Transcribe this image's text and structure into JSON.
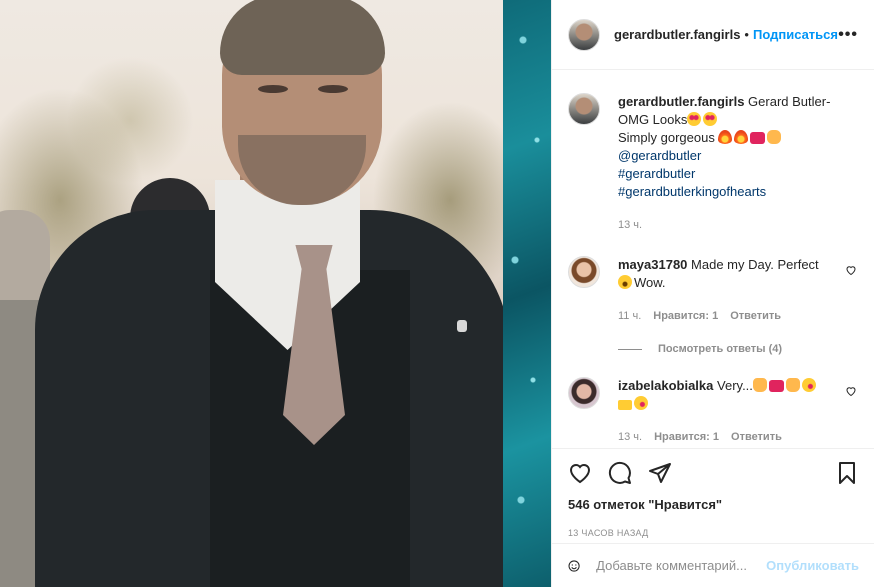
{
  "header": {
    "username": "gerardbutler.fangirls",
    "separator": "•",
    "follow_label": "Подписаться",
    "more_label": "•••"
  },
  "caption": {
    "username": "gerardbutler.fangirls",
    "text_1": "Gerard Butler-OMG Looks",
    "text_2": "Simply gorgeous",
    "mention": "@gerardbutler",
    "hashtags": [
      "#gerardbutler",
      "#gerardbutlerkingofhearts"
    ],
    "time": "13 ч."
  },
  "comments": [
    {
      "username": "maya31780",
      "text": "Made my Day. Perfect",
      "text_2": "Wow.",
      "time": "11 ч.",
      "likes": "Нравится: 1",
      "reply": "Ответить",
      "view_replies": "Посмотреть ответы (4)"
    },
    {
      "username": "izabelakobialka",
      "text": "Very...",
      "time": "13 ч.",
      "likes": "Нравится: 1",
      "reply": "Ответить"
    }
  ],
  "actions": {
    "likes_text": "546 отметок \"Нравится\"",
    "timestamp": "13 ЧАСОВ НАЗАД"
  },
  "add_comment": {
    "placeholder": "Добавьте комментарий...",
    "post_label": "Опубликовать"
  },
  "colors": {
    "link_blue": "#0095f6",
    "hashtag": "#00376b",
    "muted": "#8e8e8e",
    "teal_strip": "#1a8e9b"
  }
}
